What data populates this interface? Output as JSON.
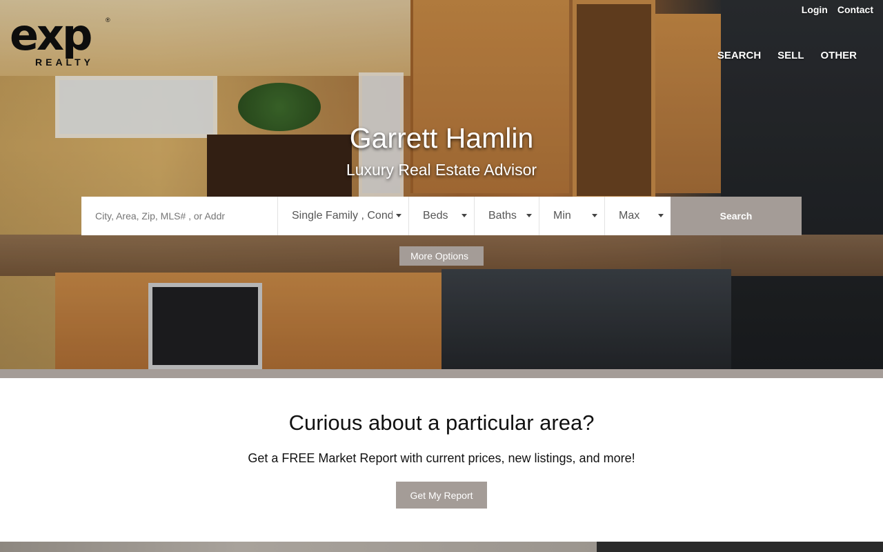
{
  "brand": {
    "logo_mark": "exp",
    "logo_sub": "REALTY",
    "reg": "®"
  },
  "top_links": [
    {
      "icon": "lock-icon",
      "glyph": "",
      "label": "Login"
    },
    {
      "icon": "phone-icon",
      "glyph": "",
      "label": "Contact"
    }
  ],
  "nav": [
    {
      "label": "SEARCH"
    },
    {
      "label": "SELL"
    },
    {
      "label": "OTHER",
      "caret": ""
    }
  ],
  "hero": {
    "name": "Garrett Hamlin",
    "title": "Luxury Real Estate Advisor"
  },
  "search": {
    "placeholder": "City, Area, Zip, MLS# , or Addr",
    "property_type": "Single Family , Condo",
    "beds": "Beds",
    "baths": "Baths",
    "min": "Min",
    "max": "Max",
    "button": "Search",
    "more_options": "More Options",
    "more_icon": ""
  },
  "report": {
    "heading": "Curious about a particular area?",
    "text": "Get a FREE Market Report with current prices, new listings, and more!",
    "button": "Get My Report"
  },
  "colors": {
    "accent": "#a49c97",
    "text": "#111111",
    "white": "#ffffff"
  }
}
